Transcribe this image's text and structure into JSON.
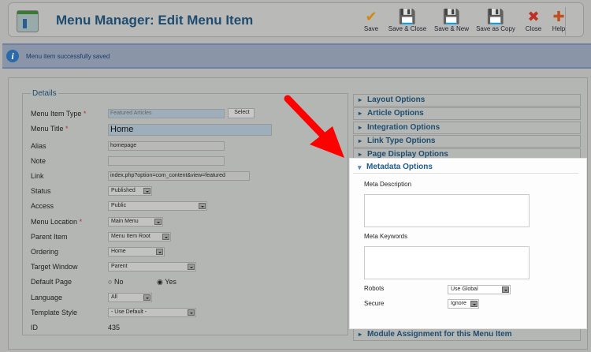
{
  "header": {
    "title": "Menu Manager: Edit Menu Item",
    "buttons": [
      {
        "label": "Save",
        "icon": "checkmark-icon",
        "glyph": "✔",
        "color": "#d08a10"
      },
      {
        "label": "Save & Close",
        "icon": "floppy-icon",
        "glyph": "💾",
        "color": "#333"
      },
      {
        "label": "Save & New",
        "icon": "floppy-plus-icon",
        "glyph": "💾",
        "color": "#333"
      },
      {
        "label": "Save as Copy",
        "icon": "floppy-copy-icon",
        "glyph": "💾",
        "color": "#333"
      },
      {
        "label": "Close",
        "icon": "close-icon",
        "glyph": "✖",
        "color": "#c03020"
      },
      {
        "label": "Help",
        "icon": "lifebuoy-icon",
        "glyph": "✚",
        "color": "#c05020"
      }
    ]
  },
  "message": {
    "text": "Menu item successfully saved",
    "icon": "info-icon"
  },
  "details": {
    "legend": "Details",
    "fields": [
      {
        "label": "Menu Item Type",
        "required": true,
        "value": "Featured Articles",
        "button": "Select"
      },
      {
        "label": "Menu Title",
        "required": true,
        "value": "Home"
      },
      {
        "label": "Alias",
        "value": "homepage"
      },
      {
        "label": "Note",
        "value": ""
      },
      {
        "label": "Link",
        "value": "index.php?option=com_content&view=featured"
      },
      {
        "label": "Status",
        "value": "Published"
      },
      {
        "label": "Access",
        "value": "Public"
      },
      {
        "label": "Menu Location",
        "required": true,
        "value": "Main Menu"
      },
      {
        "label": "Parent Item",
        "value": "Menu Item Root"
      },
      {
        "label": "Ordering",
        "value": "Home"
      },
      {
        "label": "Target Window",
        "value": "Parent"
      },
      {
        "label": "Default Page",
        "options": [
          "No",
          "Yes"
        ],
        "selected": "Yes"
      },
      {
        "label": "Language",
        "value": "All"
      },
      {
        "label": "Template Style",
        "value": "- Use Default -"
      },
      {
        "label": "ID",
        "value": "435"
      }
    ]
  },
  "accordion": {
    "panels": [
      "Layout Options",
      "Article Options",
      "Integration Options",
      "Link Type Options",
      "Page Display Options"
    ],
    "open": {
      "title": "Metadata Options",
      "meta_description": "Meta Description",
      "meta_keywords": "Meta Keywords",
      "robots_label": "Robots",
      "robots": "Use Global",
      "secure_label": "Secure",
      "secure": "Ignore"
    },
    "last": "Module Assignment for this Menu Item"
  },
  "annotation": {
    "arrow_color": "#ff0000"
  }
}
